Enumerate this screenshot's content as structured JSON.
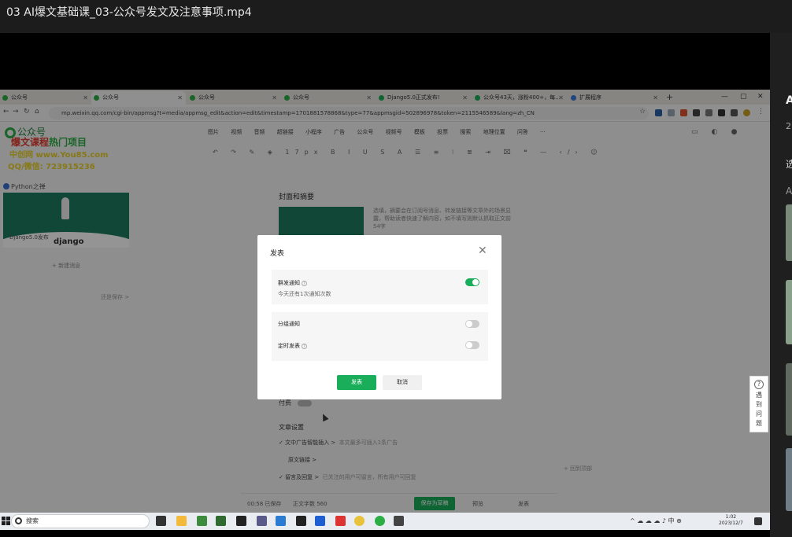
{
  "player": {
    "title": "03 AI爆文基础课_03-公众号发文及注意事项.mp4"
  },
  "side_panel": {
    "title_letter": "A",
    "count": "2",
    "label_a": "选",
    "label_b": "A"
  },
  "browser": {
    "tabs": [
      {
        "label": "公众号",
        "active": false
      },
      {
        "label": "公众号",
        "active": true
      },
      {
        "label": "公众号",
        "active": false
      },
      {
        "label": "公众号",
        "active": false
      },
      {
        "label": "Django5.0正式发布!",
        "active": false
      },
      {
        "label": "公众号43天，涨粉400+，每…",
        "active": false
      },
      {
        "label": "扩展程序",
        "active": false
      }
    ],
    "new_tab": "+",
    "url": "mp.weixin.qq.com/cgi-bin/appmsg?t=media/appmsg_edit&action=edit&timestamp=1701881578868&type=77&appmsgid=502896978&token=2115546589&lang=zh_CN"
  },
  "editor": {
    "logo_text": "公众号",
    "watermark": {
      "line1_red": "爆文课程",
      "line1_green": "热门项目",
      "line2": "中创网 www.You85.com",
      "line3": "QQ/微信: 723915236"
    },
    "account_name": "Python之禅",
    "cover_small_text": "Django5.0发布",
    "cover_brand": "django",
    "add_article": "+ 新建消息",
    "edit_link": "还是保存 >",
    "menu_items": [
      "图片",
      "视频",
      "音频",
      "超链接",
      "小程序",
      "广告",
      "公众号",
      "视频号",
      "模板",
      "投票",
      "搜索",
      "地理位置",
      "问答",
      "···"
    ],
    "toolbar_glyphs": "↶ ↷ ✎ ◈ 17px B I U S A ☰ ≡ ⁝ ≣ ⇥ ⌧ ❝ — ‹/› ☺",
    "cover_section_title": "封面和摘要",
    "cover_description": "选填，摘要会在订阅号消息、转发链接等文章外的场景显露，帮助读者快速了解内容，如不填写则默认抓取正文前54字",
    "paid_label": "付费",
    "article_settings": "文章设置",
    "option1": "✓ 文中广告智能插入 >",
    "option1_note": "本文最多可插入1条广告",
    "option2": "原文链接 >",
    "option3": "✓ 留言及回复 >",
    "option3_note": "已关注的用户可留言，所有用户可回复",
    "footer_time": "00:58 已保存",
    "footer_words": "正文字数 560",
    "save_button": "保存为草稿",
    "preview_button": "预览",
    "publish_footer_button": "发表",
    "float_tip": "+ 回到顶部",
    "help_chars": [
      "遇",
      "到",
      "问",
      "题"
    ]
  },
  "dialog": {
    "title": "发表",
    "mass_notify_label": "群发通知",
    "mass_notify_sub": "今天还有1次通知次数",
    "mass_notify_on": true,
    "group_notify_label": "分组通知",
    "group_notify_on": false,
    "scheduled_label": "定时发表",
    "scheduled_on": false,
    "publish_button": "发表",
    "cancel_button": "取消"
  },
  "taskbar": {
    "search_placeholder": "搜索",
    "tray_text": "^ ☁ ☁ ☁ ♪ 中 ⊕",
    "time": "1:02",
    "date": "2023/12/7"
  },
  "colors": {
    "accent_green": "#1aad5a",
    "player_bg": "#1c1c1c",
    "overlay": "rgba(0,0,0,0.42)"
  }
}
